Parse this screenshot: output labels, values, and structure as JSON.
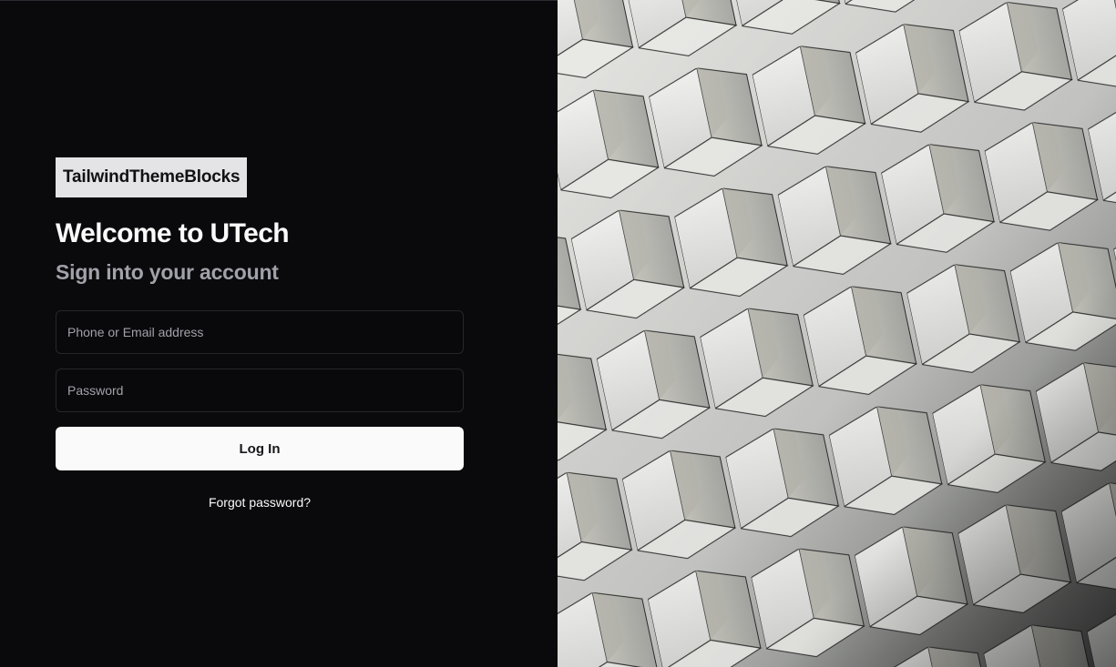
{
  "brand": {
    "label": "TailwindThemeBlocks"
  },
  "heading": {
    "title": "Welcome to UTech",
    "subtitle": "Sign into your account"
  },
  "form": {
    "email_placeholder": "Phone or Email address",
    "email_value": "",
    "password_placeholder": "Password",
    "password_value": "",
    "login_label": "Log In",
    "forgot_label": "Forgot password?"
  },
  "colors": {
    "background": "#0a0a0c",
    "button": "#fafafa",
    "muted_text": "#a1a1aa"
  },
  "image": {
    "description_name": "architectural-facade-photo"
  }
}
